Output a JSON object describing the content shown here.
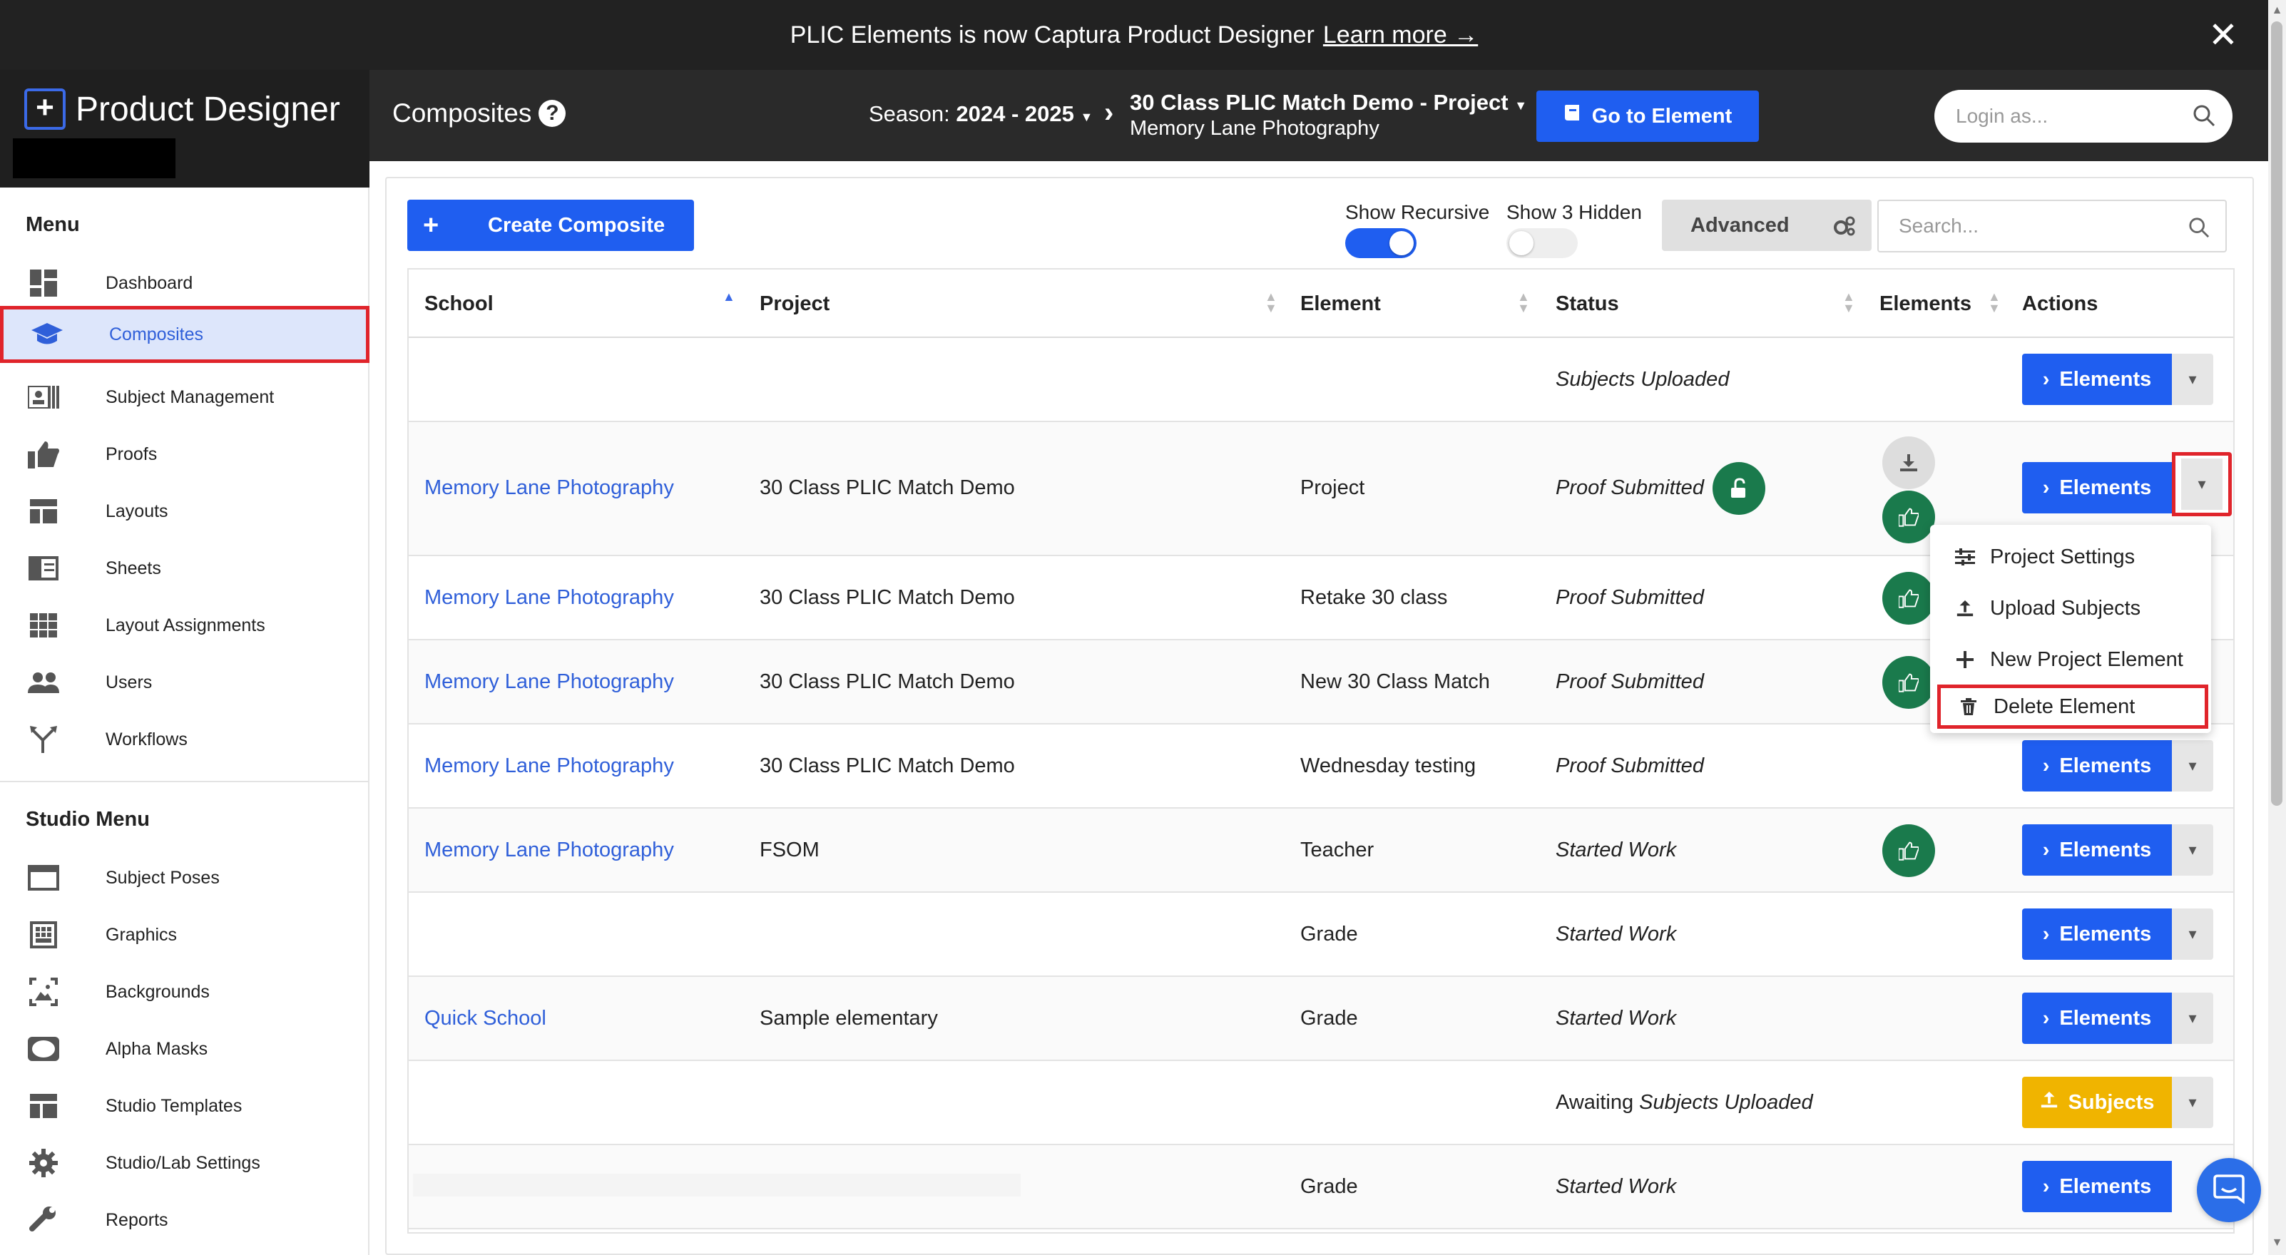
{
  "banner": {
    "text": "PLIC Elements is now Captura Product Designer",
    "link": "Learn more →",
    "close": "✕"
  },
  "app": {
    "title": "Product Designer"
  },
  "sidebar": {
    "menu_title": "Menu",
    "items": [
      {
        "label": "Dashboard",
        "icon": "dashboard-icon"
      },
      {
        "label": "Composites",
        "icon": "graduation-cap-icon",
        "active": true
      },
      {
        "label": "Subject Management",
        "icon": "id-card-icon"
      },
      {
        "label": "Proofs",
        "icon": "thumbs-up-icon"
      },
      {
        "label": "Layouts",
        "icon": "layout-icon"
      },
      {
        "label": "Sheets",
        "icon": "sheet-icon"
      },
      {
        "label": "Layout Assignments",
        "icon": "grid-icon"
      },
      {
        "label": "Users",
        "icon": "users-icon"
      },
      {
        "label": "Workflows",
        "icon": "workflow-icon"
      }
    ],
    "studio_title": "Studio Menu",
    "studio_items": [
      {
        "label": "Subject Poses",
        "icon": "window-icon"
      },
      {
        "label": "Graphics",
        "icon": "graphics-icon"
      },
      {
        "label": "Backgrounds",
        "icon": "image-icon"
      },
      {
        "label": "Alpha Masks",
        "icon": "mask-icon"
      },
      {
        "label": "Studio Templates",
        "icon": "template-icon"
      },
      {
        "label": "Studio/Lab Settings",
        "icon": "gear-icon"
      },
      {
        "label": "Reports",
        "icon": "wrench-icon"
      }
    ]
  },
  "topbar": {
    "page_title": "Composites",
    "season_label": "Season:",
    "season_value": "2024 - 2025",
    "project_name": "30 Class PLIC Match Demo - Project",
    "project_sub": "Memory Lane Photography",
    "go_button": "Go to Element",
    "login_placeholder": "Login as..."
  },
  "toolbar": {
    "create_button": "Create Composite",
    "show_recursive": "Show Recursive",
    "show_hidden": "Show 3 Hidden",
    "advanced": "Advanced",
    "search_placeholder": "Search..."
  },
  "table": {
    "headers": {
      "school": "School",
      "project": "Project",
      "element": "Element",
      "status": "Status",
      "elements": "Elements",
      "actions": "Actions"
    },
    "rows": [
      {
        "school": "",
        "project": "",
        "element": "",
        "status": "Subjects Uploaded",
        "button": "Elements"
      },
      {
        "school": "Memory Lane Photography",
        "project": "30 Class PLIC Match Demo",
        "element": "Project",
        "status": "Proof Submitted",
        "button": "Elements"
      },
      {
        "school": "Memory Lane Photography",
        "project": "30 Class PLIC Match Demo",
        "element": "Retake 30 class",
        "status": "Proof Submitted",
        "button": "Elements"
      },
      {
        "school": "Memory Lane Photography",
        "project": "30 Class PLIC Match Demo",
        "element": "New 30 Class Match",
        "status": "Proof Submitted",
        "button": "Elements"
      },
      {
        "school": "Memory Lane Photography",
        "project": "30 Class PLIC Match Demo",
        "element": "Wednesday testing",
        "status": "Proof Submitted",
        "button": "Elements"
      },
      {
        "school": "Memory Lane Photography",
        "project": "FSOM",
        "element": "Teacher",
        "status": "Started Work",
        "button": "Elements"
      },
      {
        "school": "",
        "project": "",
        "element": "Grade",
        "status": "Started Work",
        "button": "Elements"
      },
      {
        "school": "Quick School",
        "project": "Sample elementary",
        "element": "Grade",
        "status": "Started Work",
        "button": "Elements"
      },
      {
        "school": "",
        "project": "",
        "element": "",
        "status_prefix": "Awaiting",
        "status": "Subjects Uploaded",
        "button": "Subjects"
      },
      {
        "school": "",
        "project": "",
        "element": "Grade",
        "status": "Started Work",
        "button": "Elements"
      }
    ]
  },
  "dropdown": {
    "items": [
      {
        "label": "Project Settings",
        "icon": "sliders-icon"
      },
      {
        "label": "Upload Subjects",
        "icon": "upload-icon"
      },
      {
        "label": "New Project Element",
        "icon": "plus-icon"
      },
      {
        "label": "Delete Element",
        "icon": "trash-icon"
      }
    ]
  },
  "colors": {
    "accent": "#1f5ef0",
    "highlight": "#e0242b",
    "green": "#1a7a4c",
    "yellow": "#f0b400"
  }
}
